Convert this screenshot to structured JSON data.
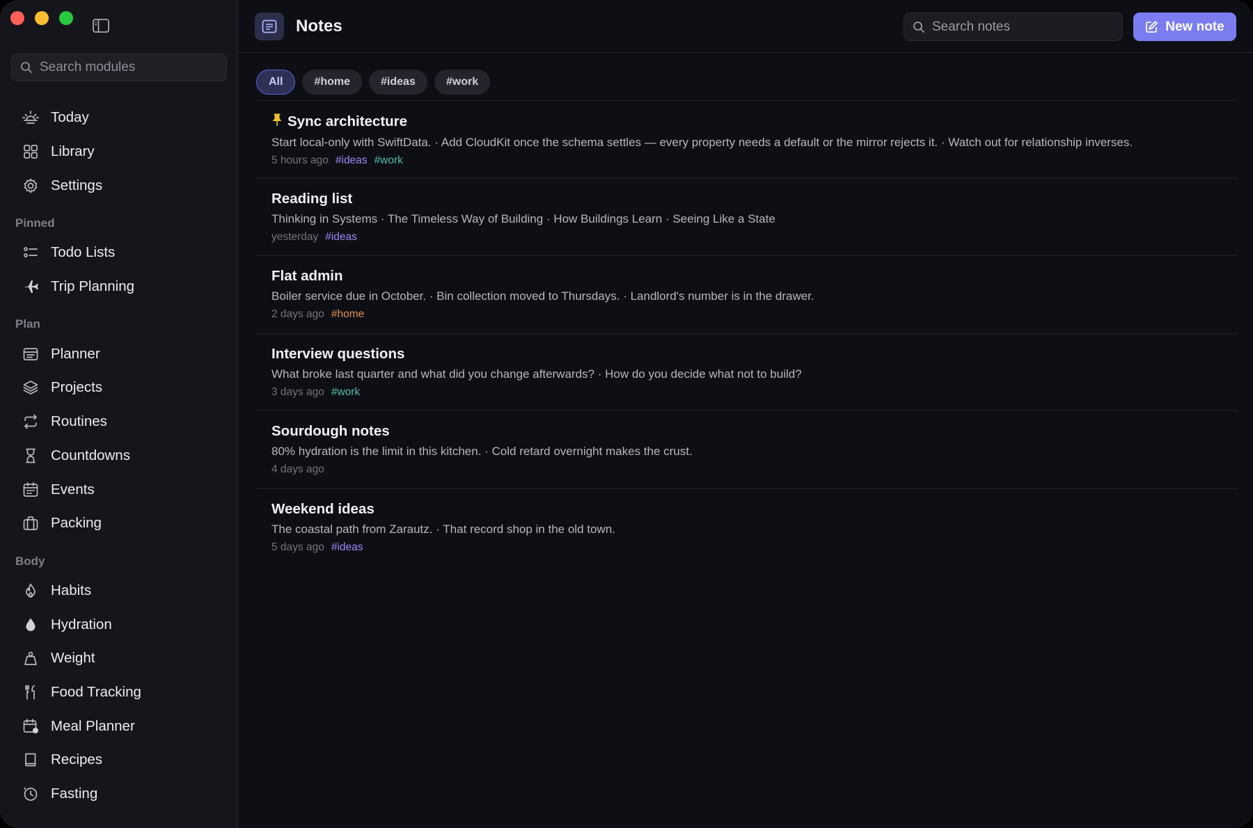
{
  "sidebar": {
    "search_placeholder": "Search modules",
    "top_items": [
      {
        "label": "Today",
        "icon": "sunrise-icon"
      },
      {
        "label": "Library",
        "icon": "grid-icon"
      },
      {
        "label": "Settings",
        "icon": "gear-icon"
      }
    ],
    "sections": [
      {
        "title": "Pinned",
        "items": [
          {
            "label": "Todo Lists",
            "icon": "checklist-icon"
          },
          {
            "label": "Trip Planning",
            "icon": "airplane-icon"
          }
        ]
      },
      {
        "title": "Plan",
        "items": [
          {
            "label": "Planner",
            "icon": "planner-icon"
          },
          {
            "label": "Projects",
            "icon": "layers-icon"
          },
          {
            "label": "Routines",
            "icon": "repeat-icon"
          },
          {
            "label": "Countdowns",
            "icon": "hourglass-icon"
          },
          {
            "label": "Events",
            "icon": "calendar-icon"
          },
          {
            "label": "Packing",
            "icon": "suitcase-icon"
          }
        ]
      },
      {
        "title": "Body",
        "items": [
          {
            "label": "Habits",
            "icon": "flame-icon"
          },
          {
            "label": "Hydration",
            "icon": "drop-icon"
          },
          {
            "label": "Weight",
            "icon": "scale-icon"
          },
          {
            "label": "Food Tracking",
            "icon": "fork-knife-icon"
          },
          {
            "label": "Meal Planner",
            "icon": "meal-calendar-icon"
          },
          {
            "label": "Recipes",
            "icon": "book-icon"
          },
          {
            "label": "Fasting",
            "icon": "timer-icon"
          }
        ]
      }
    ]
  },
  "header": {
    "title": "Notes",
    "search_placeholder": "Search notes",
    "new_note_label": "New note"
  },
  "filters": [
    {
      "label": "All",
      "active": true
    },
    {
      "label": "#home",
      "active": false
    },
    {
      "label": "#ideas",
      "active": false
    },
    {
      "label": "#work",
      "active": false
    }
  ],
  "notes": [
    {
      "title": "Sync architecture",
      "pinned": true,
      "preview": "Start local-only with SwiftData. · Add CloudKit once the schema settles — every property needs a default or the mirror rejects it. · Watch out for relationship inverses.",
      "time": "5 hours ago",
      "tags": [
        "#ideas",
        "#work"
      ]
    },
    {
      "title": "Reading list",
      "pinned": false,
      "preview": "Thinking in Systems · The Timeless Way of Building · How Buildings Learn · Seeing Like a State",
      "time": "yesterday",
      "tags": [
        "#ideas"
      ]
    },
    {
      "title": "Flat admin",
      "pinned": false,
      "preview": "Boiler service due in October. · Bin collection moved to Thursdays. · Landlord's number is in the drawer.",
      "time": "2 days ago",
      "tags": [
        "#home"
      ]
    },
    {
      "title": "Interview questions",
      "pinned": false,
      "preview": "What broke last quarter and what did you change afterwards? · How do you decide what not to build?",
      "time": "3 days ago",
      "tags": [
        "#work"
      ]
    },
    {
      "title": "Sourdough notes",
      "pinned": false,
      "preview": "80% hydration is the limit in this kitchen. · Cold retard overnight makes the crust.",
      "time": "4 days ago",
      "tags": []
    },
    {
      "title": "Weekend ideas",
      "pinned": false,
      "preview": "The coastal path from Zarautz. · That record shop in the old town.",
      "time": "5 days ago",
      "tags": [
        "#ideas"
      ]
    }
  ],
  "colors": {
    "accent": "#7a7cf0",
    "tag_ideas": "#a084f5",
    "tag_work": "#4fbdb0",
    "tag_home": "#e3904a"
  }
}
